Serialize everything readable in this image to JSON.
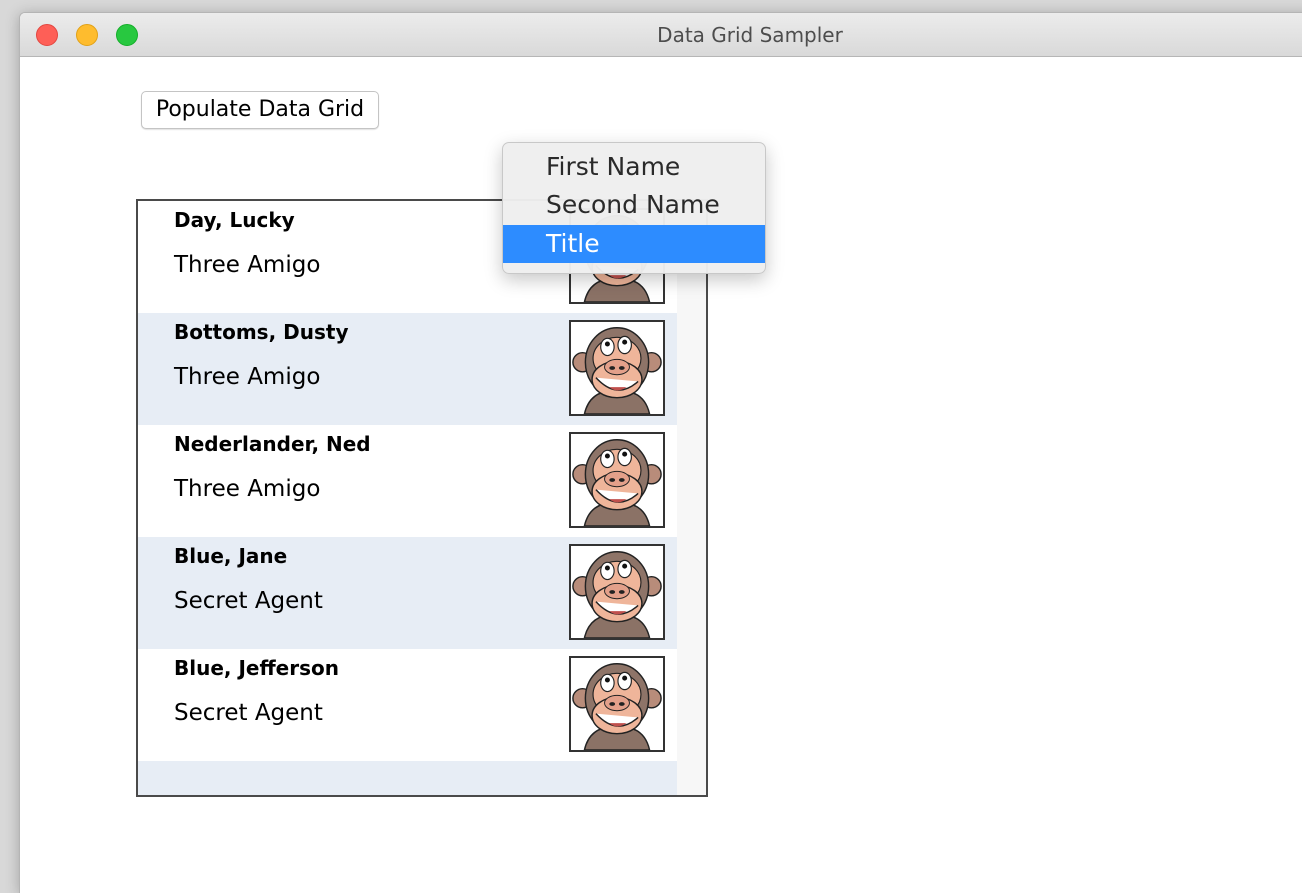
{
  "window": {
    "title": "Data Grid Sampler"
  },
  "toolbar": {
    "populate_label": "Populate Data Grid"
  },
  "grid": {
    "rows": [
      {
        "name": "Day, Lucky",
        "title": "Three Amigo",
        "image": "monkey-avatar"
      },
      {
        "name": "Bottoms, Dusty",
        "title": "Three Amigo",
        "image": "monkey-avatar"
      },
      {
        "name": "Nederlander, Ned",
        "title": "Three Amigo",
        "image": "monkey-avatar"
      },
      {
        "name": "Blue, Jane",
        "title": "Secret Agent",
        "image": "monkey-avatar"
      },
      {
        "name": "Blue, Jefferson",
        "title": "Secret Agent",
        "image": "monkey-avatar"
      }
    ]
  },
  "context_menu": {
    "items": [
      {
        "label": "First Name",
        "selected": false
      },
      {
        "label": "Second Name",
        "selected": false
      },
      {
        "label": "Title",
        "selected": true
      }
    ]
  },
  "colors": {
    "row_alt": "#e7edf5",
    "menu_highlight": "#2d8cff",
    "close": "#fe5f57",
    "minimize": "#febc2e",
    "zoom": "#28c840"
  }
}
